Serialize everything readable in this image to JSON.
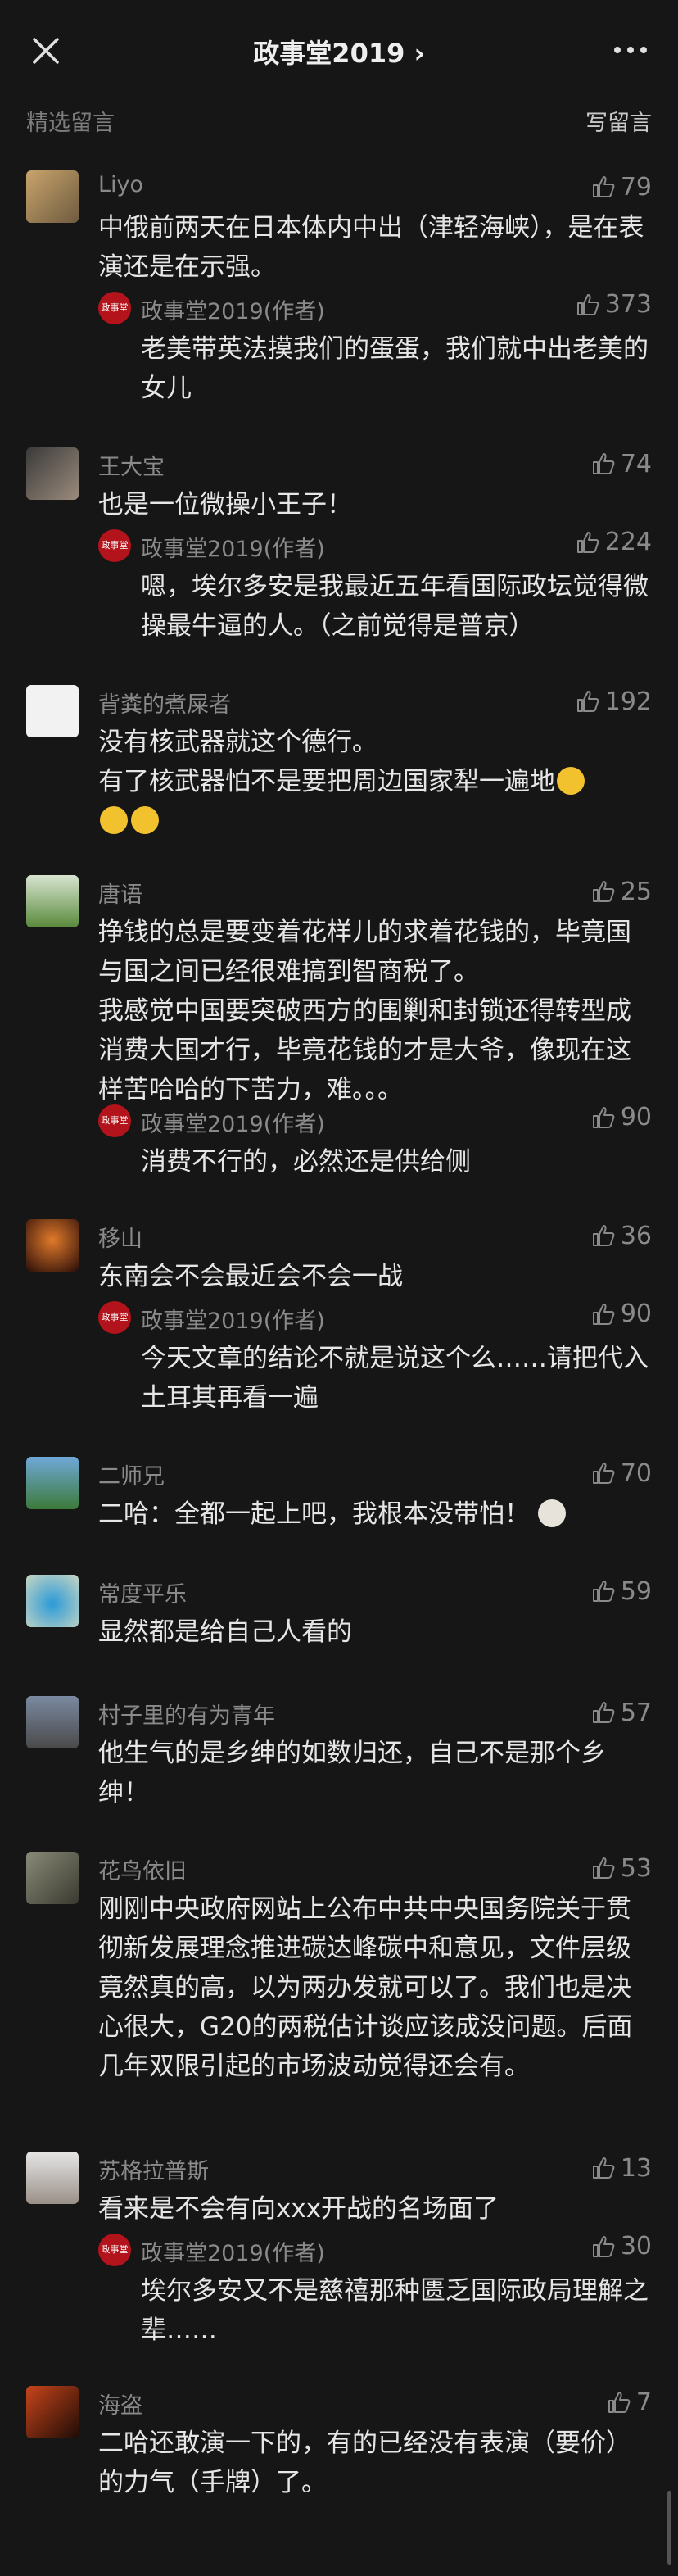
{
  "header": {
    "title": "政事堂2019 ›"
  },
  "section": {
    "label": "精选留言",
    "write_label": "写留言"
  },
  "author_name": "政事堂2019(作者)",
  "author_logo_text": "政事堂",
  "comments": [
    {
      "name": "Liyo",
      "likes": "79",
      "body": [
        "中俄前两天在日本体内中出（津轻海峡），是在表演还是在示强。"
      ],
      "reply": {
        "likes": "373",
        "body": [
          "老美带英法摸我们的蛋蛋，我们就中出老美的女儿"
        ]
      }
    },
    {
      "name": "王大宝",
      "likes": "74",
      "body": [
        "也是一位微操小王子！"
      ],
      "reply": {
        "likes": "224",
        "body": [
          "嗯，埃尔多安是我最近五年看国际政坛觉得微操最牛逼的人。（之前觉得是普京）"
        ]
      }
    },
    {
      "name": "背粪的煮屎者",
      "likes": "192",
      "body": [
        "没有核武器就这个德行。",
        "有了核武器怕不是要把周边国家犁一遍地"
      ]
    },
    {
      "name": "唐语",
      "likes": "25",
      "body": [
        "挣钱的总是要变着花样儿的求着花钱的，毕竟国与国之间已经很难搞到智商税了。",
        "我感觉中国要突破西方的围剿和封锁还得转型成消费大国才行，毕竟花钱的才是大爷，像现在这样苦哈哈的下苦力，难。。。"
      ],
      "reply": {
        "likes": "90",
        "body": [
          "消费不行的，必然还是供给侧"
        ]
      }
    },
    {
      "name": "移山",
      "likes": "36",
      "body": [
        "东南会不会最近会不会一战"
      ],
      "reply": {
        "likes": "90",
        "body": [
          "今天文章的结论不就是说这个么……请把代入土耳其再看一遍"
        ]
      }
    },
    {
      "name": "二师兄",
      "likes": "70",
      "body": [
        "二哈：全都一起上吧，我根本没带怕！"
      ]
    },
    {
      "name": "常度平乐",
      "likes": "59",
      "body": [
        "显然都是给自己人看的"
      ]
    },
    {
      "name": "村子里的有为青年",
      "likes": "57",
      "body": [
        "他生气的是乡绅的如数归还，自己不是那个乡绅！"
      ]
    },
    {
      "name": "花鸟依旧",
      "likes": "53",
      "body": [
        "刚刚中央政府网站上公布中共中央国务院关于贯彻新发展理念推进碳达峰碳中和意见，文件层级竟然真的高，以为两办发就可以了。我们也是决心很大，G20的两税估计谈应该成没问题。后面几年双限引起的市场波动觉得还会有。"
      ]
    },
    {
      "name": "苏格拉普斯",
      "likes": "13",
      "body": [
        "看来是不会有向xxx开战的名场面了"
      ],
      "reply": {
        "likes": "30",
        "body": [
          "埃尔多安又不是慈禧那种匮乏国际政局理解之辈……"
        ]
      }
    },
    {
      "name": "海盗",
      "likes": "7",
      "body": [
        "二哈还敢演一下的，有的已经没有表演（要价）的力气（手牌）了。"
      ]
    }
  ],
  "colors": {
    "background": "#161616",
    "text": "#e6e6e6",
    "muted": "#8a8a8a",
    "logo_red": "#b3141c"
  }
}
